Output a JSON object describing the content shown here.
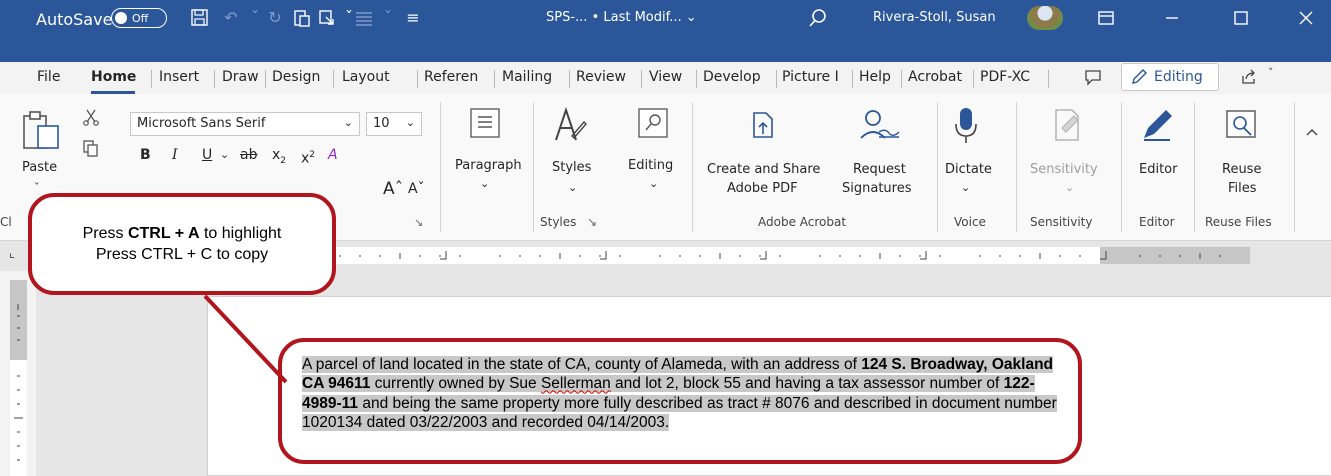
{
  "titlebar": {
    "autosave_label": "AutoSave",
    "autosave_state": "Off",
    "doc_title": "SPS-...  • Last Modif... ⌄",
    "user_name": "Rivera-Stoll, Susan",
    "bg_color": "#2b579a"
  },
  "tabs": [
    {
      "label": "File"
    },
    {
      "label": "Home"
    },
    {
      "label": "Insert"
    },
    {
      "label": "Draw"
    },
    {
      "label": "Design"
    },
    {
      "label": "Layout"
    },
    {
      "label": "Referen"
    },
    {
      "label": "Mailing"
    },
    {
      "label": "Review"
    },
    {
      "label": "View"
    },
    {
      "label": "Develop"
    },
    {
      "label": "Picture I"
    },
    {
      "label": "Help"
    },
    {
      "label": "Acrobat"
    },
    {
      "label": "PDF-XC"
    }
  ],
  "editing_mode": {
    "label": "Editing",
    "chevron": "˅"
  },
  "share": {
    "chevron": "˅"
  },
  "ribbon": {
    "paste_label": "Paste",
    "clipboard_label": "Cl",
    "font_name": "Microsoft Sans Serif",
    "font_size": "10",
    "paragraph_label": "Paragraph",
    "styles_label": "Styles",
    "styles_group_label": "Styles",
    "editing_label": "Editing",
    "create_share_line1": "Create and Share",
    "create_share_line2": "Adobe PDF",
    "request_line1": "Request",
    "request_line2": "Signatures",
    "adobe_group_label": "Adobe Acrobat",
    "dictate_label": "Dictate",
    "voice_group_label": "Voice",
    "sensitivity_label": "Sensitivity",
    "sensitivity_group_label": "Sensitivity",
    "editor_label": "Editor",
    "editor_group_label": "Editor",
    "reuse_line1": "Reuse",
    "reuse_line2": "Files",
    "reuse_group_label": "Reuse Files"
  },
  "callout": {
    "line1_pre": "Press ",
    "line1_keys": "CTRL + A",
    "line1_post": " to highlight",
    "line2": "Press CTRL + C to copy",
    "color": "#b1151d"
  },
  "document": {
    "p1": "A parcel of land located in the state of CA, county of Alameda, with an address of ",
    "address": "124 S. Broadway, Oakland CA 94611",
    "p2": " currently owned by Sue ",
    "owner_last": "Sellerman",
    "p3": " and lot 2, block 55 and having a tax assessor number of ",
    "tax_number": "122-4989-11",
    "p4": " and being the same property more fully described as tract # 8076 and described in document number 1020134 dated 03/22/2003 and recorded 04/14/2003."
  }
}
